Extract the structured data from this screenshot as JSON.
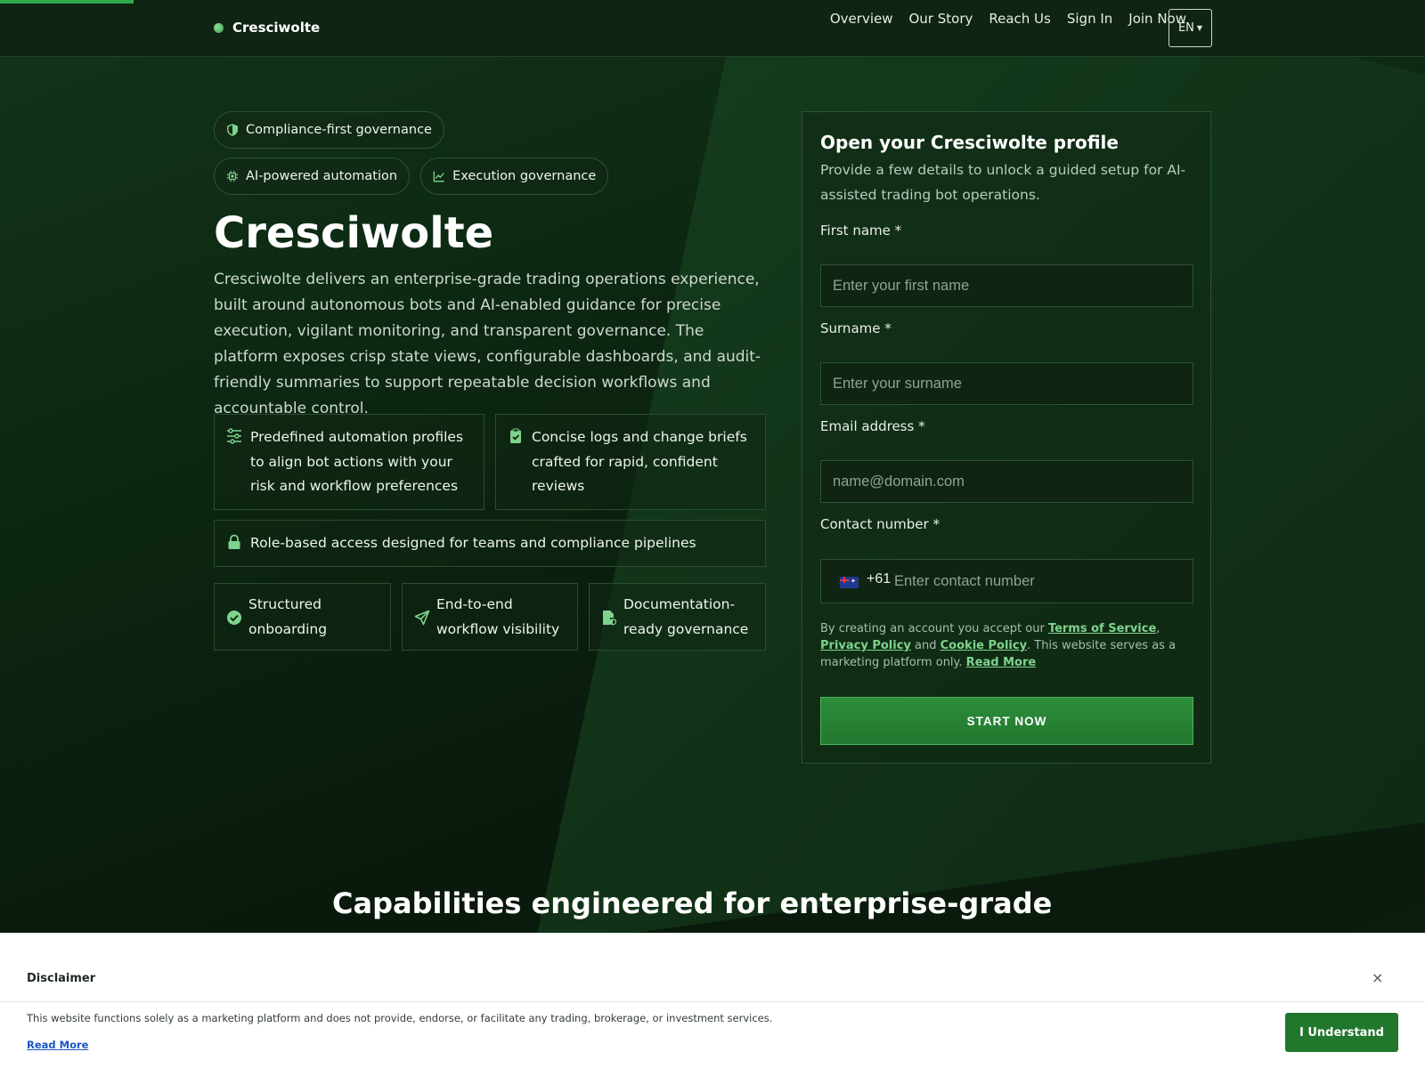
{
  "header": {
    "brand": "Cresciwolte",
    "nav": [
      "Overview",
      "Our Story",
      "Reach Us",
      "Sign In",
      "Join Now"
    ],
    "language": "EN"
  },
  "hero": {
    "chips": [
      {
        "icon": "shield-icon",
        "label": "Compliance-first governance"
      },
      {
        "icon": "chip-icon",
        "label": "AI-powered automation"
      },
      {
        "icon": "chart-line-icon",
        "label": "Execution governance"
      }
    ],
    "title": "Cresciwolte",
    "description": "Cresciwolte delivers an enterprise-grade trading operations experience, built around autonomous bots and AI-enabled guidance for precise execution, vigilant monitoring, and transparent governance. The platform exposes crisp state views, configurable dashboards, and audit-friendly summaries to support repeatable decision workflows and accountable control.",
    "features": [
      {
        "icon": "sliders-icon",
        "text": "Predefined automation profiles to align bot actions with your risk and workflow preferences"
      },
      {
        "icon": "clipboard-check-icon",
        "text": "Concise logs and change briefs crafted for rapid, confident reviews"
      },
      {
        "icon": "lock-icon",
        "text": "Role-based access designed for teams and compliance pipelines"
      }
    ],
    "highlights": [
      {
        "icon": "check-circle-icon",
        "text": "Structured onboarding"
      },
      {
        "icon": "send-icon",
        "text": "End-to-end workflow visibility"
      },
      {
        "icon": "file-shield-icon",
        "text": "Documentation-ready governance"
      }
    ]
  },
  "form": {
    "title": "Open your Cresciwolte profile",
    "subtitle": "Provide a few details to unlock a guided setup for AI-assisted trading bot operations.",
    "first_name_label": "First name *",
    "first_name_placeholder": "Enter your first name",
    "surname_label": "Surname *",
    "surname_placeholder": "Enter your surname",
    "email_label": "Email address *",
    "email_placeholder": "name@domain.com",
    "phone_label": "Contact number *",
    "phone_dial": "+61",
    "phone_placeholder": "Enter contact number",
    "legal": {
      "prefix": "By creating an account you accept our ",
      "terms": "Terms of Service",
      "sep1": ", ",
      "privacy": "Privacy Policy",
      "sep2": " and ",
      "cookie": "Cookie Policy",
      "suffix": ". This website serves as a marketing platform only. ",
      "read_more": "Read More"
    },
    "cta": "START NOW"
  },
  "capabilities_title": "Capabilities engineered for enterprise-grade",
  "disclaimer": {
    "title": "Disclaimer",
    "close": "×",
    "text": "This website functions solely as a marketing platform and does not provide, endorse, or facilitate any trading, brokerage, or investment services.",
    "read_more": "Read More",
    "button": "I Understand"
  },
  "colors": {
    "accent": "#2fa84a",
    "background": "#0b1a0e",
    "link": "#7fd38e",
    "cta": "#23782f"
  }
}
